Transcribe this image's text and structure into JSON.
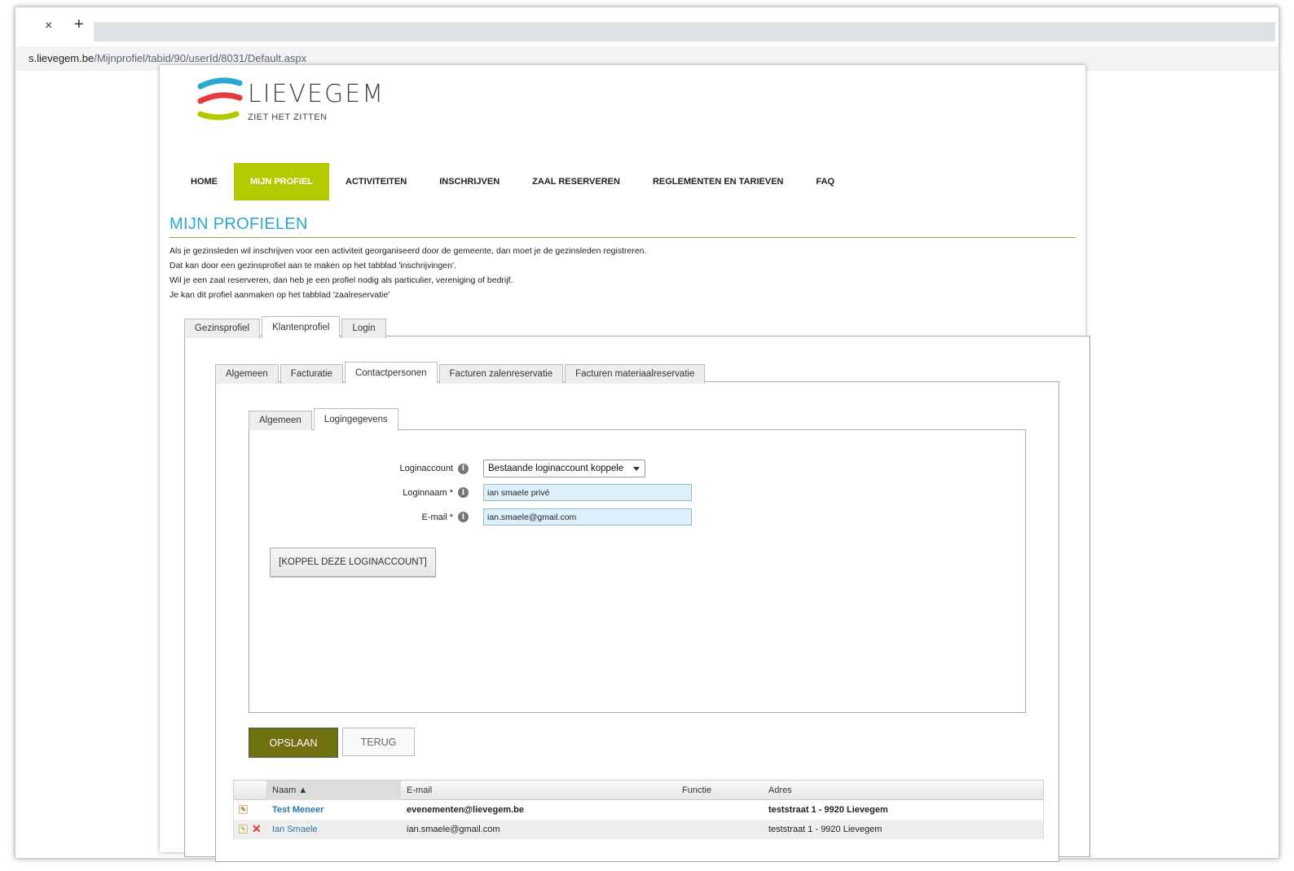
{
  "browser": {
    "close_glyph": "×",
    "new_tab_glyph": "+",
    "url_host": "s.lievegem.be",
    "url_path": "/Mijnprofiel/tabid/90/userId/8031/Default.aspx"
  },
  "logo": {
    "name": "LIEVEGEM",
    "tagline": "ZIET HET ZITTEN",
    "colors": [
      "#2aa7d4",
      "#e63b3b",
      "#b5c900"
    ]
  },
  "nav": {
    "items": [
      "HOME",
      "MIJN PROFIEL",
      "ACTIVITEITEN",
      "INSCHRIJVEN",
      "ZAAL RESERVEREN",
      "REGLEMENTEN EN TARIEVEN",
      "FAQ"
    ],
    "active": "MIJN PROFIEL",
    "accent": "#b5c900"
  },
  "page": {
    "title": "MIJN PROFIELEN",
    "intro": [
      "Als je gezinsleden wil inschrijven voor een activiteit georganiseerd door de gemeente, dan moet je de gezinsleden registreren.",
      "Dat kan door een gezinsprofiel aan te maken op het tabblad 'inschrijvingen'.",
      "Wil je een zaal reserveren, dan heb je een profiel nodig als particulier, vereniging of bedrijf.",
      "Je kan dit profiel aanmaken op het tabblad 'zaalreservatie'"
    ]
  },
  "tabs_level1": [
    "Gezinsprofiel",
    "Klantenprofiel",
    "Login"
  ],
  "tabs_level2": [
    "Algemeen",
    "Facturatie",
    "Contactpersonen",
    "Facturen zalenreservatie",
    "Facturen materiaalreservatie"
  ],
  "tabs_level3": [
    "Algemeen",
    "Logingegevens"
  ],
  "form": {
    "loginaccount_label": "Loginaccount",
    "loginaccount_value": "Bestaande loginaccount koppele",
    "loginnaam_label": "Loginnaam *",
    "loginnaam_value": "ian smaele privé",
    "email_label": "E-mail *",
    "email_value": "ian.smaele@gmail.com",
    "info_glyph": "i",
    "koppel_button": "[KOPPEL DEZE LOGINACCOUNT]"
  },
  "actions": {
    "save": "OPSLAAN",
    "back": "TERUG"
  },
  "grid": {
    "headers": {
      "naam": "Naam ▲",
      "email": "E-mail",
      "functie": "Functie",
      "adres": "Adres"
    },
    "rows": [
      {
        "naam": "Test Meneer",
        "email": "evenementen@lievegem.be",
        "functie": "",
        "adres": "teststraat 1 - 9920 Lievegem"
      },
      {
        "naam": "Ian Smaele",
        "email": "ian.smaele@gmail.com",
        "functie": "",
        "adres": "teststraat 1 - 9920 Lievegem"
      }
    ],
    "edit_glyph": "✎",
    "delete_glyph": "✕"
  }
}
